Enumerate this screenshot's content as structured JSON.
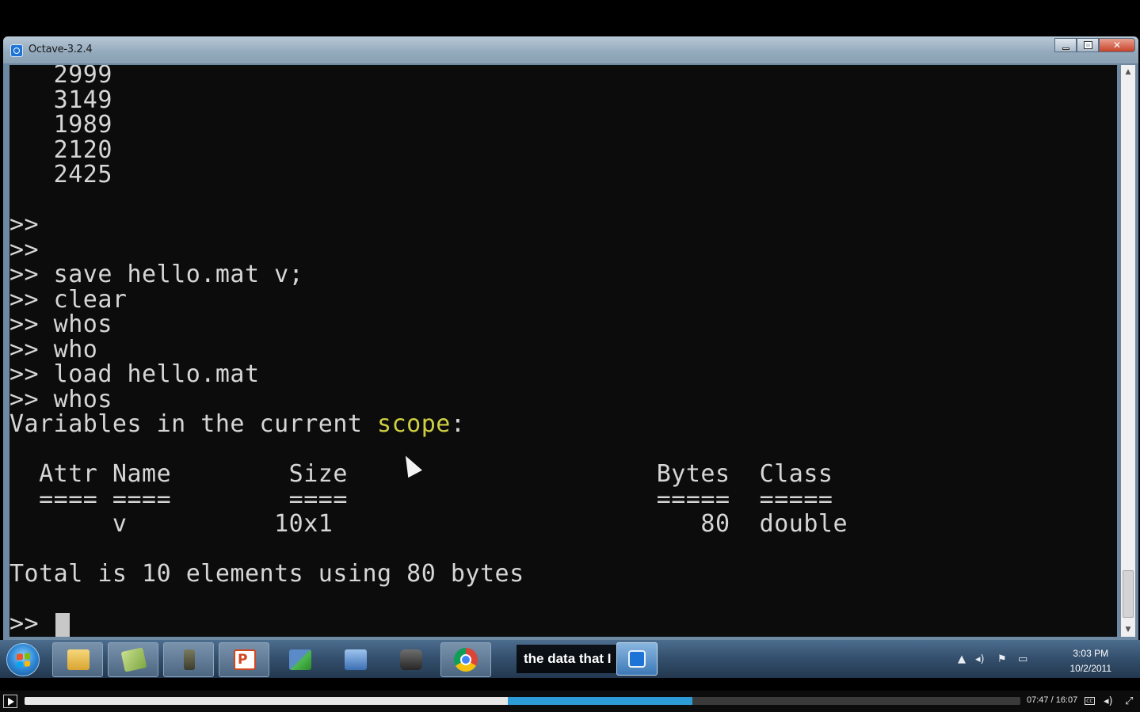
{
  "window": {
    "title": "Octave-3.2.4"
  },
  "console": {
    "lines": [
      "   2999",
      "   3149",
      "   1989",
      "   2120",
      "   2425",
      "",
      ">>",
      ">>",
      ">> save hello.mat v;",
      ">> clear",
      ">> whos",
      ">> who",
      ">> load hello.mat",
      ">> whos",
      "Variables in the current scope:",
      "",
      "  Attr Name        Size                     Bytes  Class",
      "  ==== ====        ====                     =====  =====",
      "       v          10x1                         80  double",
      "",
      "Total is 10 elements using 80 bytes",
      "",
      ">> "
    ],
    "highlight_word": "scope"
  },
  "taskbar": {
    "apps": [
      "explorer",
      "notepad",
      "tool",
      "powerpoint",
      "network",
      "connection",
      "camera",
      "chrome",
      "octave"
    ],
    "caption": "the data that I"
  },
  "tray": {
    "time": "3:03 PM",
    "date": "10/2/2011"
  },
  "player": {
    "time": "07:47 / 16:07",
    "played_fraction": 0.485,
    "buffered_fraction": 0.671,
    "cc_label": "CC"
  }
}
